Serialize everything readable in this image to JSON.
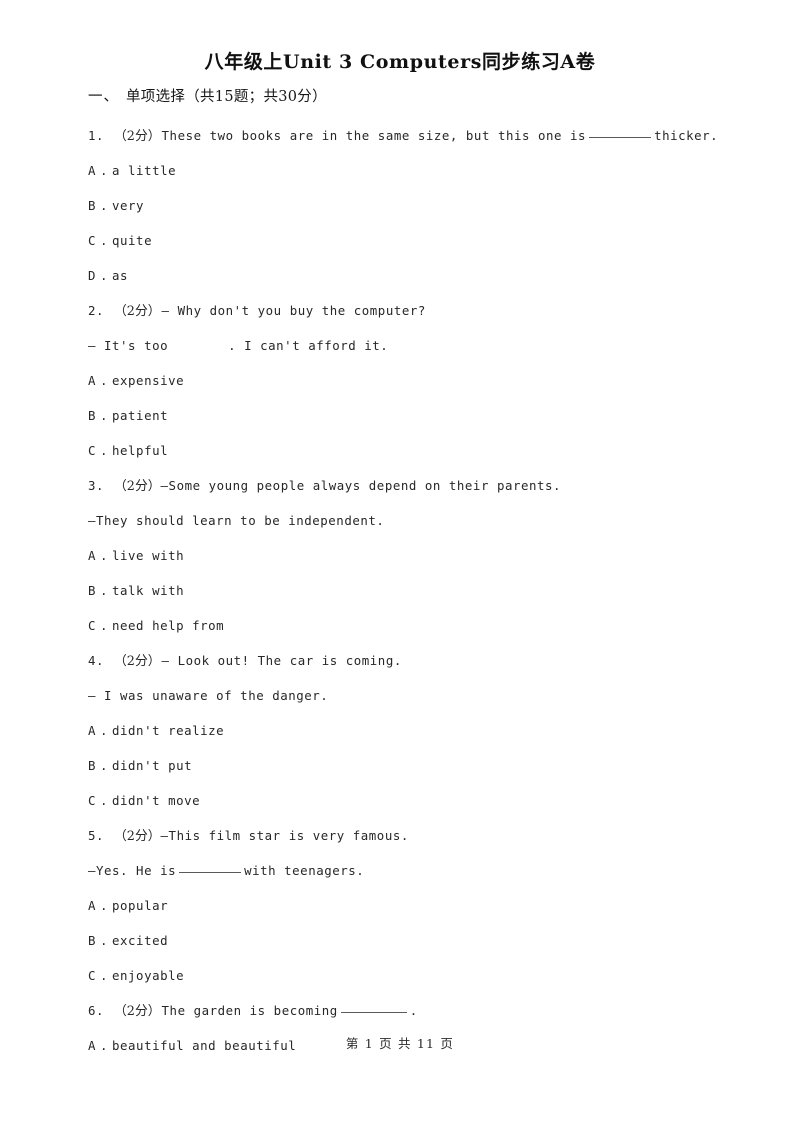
{
  "document": {
    "title": "八年级上Unit 3 Computers同步练习A卷",
    "section": {
      "number": "一、",
      "label": "单项选择（共15题；共30分）"
    },
    "footer": "第 1 页 共 11 页"
  },
  "questions": [
    {
      "number": "1.",
      "points": "（2分）",
      "stem_before": "These two books are in the same size, but this one is",
      "blank": "underline",
      "stem_after": "thicker.",
      "second_line": null,
      "options": [
        {
          "letter": "A",
          "text": "a little"
        },
        {
          "letter": "B",
          "text": "very"
        },
        {
          "letter": "C",
          "text": "quite"
        },
        {
          "letter": "D",
          "text": "as"
        }
      ]
    },
    {
      "number": "2.",
      "points": "（2分）",
      "stem_before": "— Why don't you buy the computer?",
      "blank": "none",
      "stem_after": "",
      "second_line_before": "— It's too",
      "second_line_blank": "gap",
      "second_line_after": ". I can't afford it.",
      "options": [
        {
          "letter": "A",
          "text": "expensive"
        },
        {
          "letter": "B",
          "text": "patient"
        },
        {
          "letter": "C",
          "text": "helpful"
        }
      ]
    },
    {
      "number": "3.",
      "points": "（2分）",
      "stem_before": "—Some young people always depend on their parents.",
      "blank": "none",
      "stem_after": "",
      "second_line": "—They should learn to be independent.",
      "options": [
        {
          "letter": "A",
          "text": "live with"
        },
        {
          "letter": "B",
          "text": "talk with"
        },
        {
          "letter": "C",
          "text": "need help from"
        }
      ]
    },
    {
      "number": "4.",
      "points": "（2分）",
      "stem_before": "— Look out! The car is coming.",
      "blank": "none",
      "stem_after": "",
      "second_line": "— I was unaware of the danger.",
      "options": [
        {
          "letter": "A",
          "text": "didn't realize"
        },
        {
          "letter": "B",
          "text": "didn't put"
        },
        {
          "letter": "C",
          "text": "didn't move"
        }
      ]
    },
    {
      "number": "5.",
      "points": "（2分）",
      "stem_before": "—This film star is very famous.",
      "blank": "none",
      "stem_after": "",
      "second_line_before": "—Yes. He is",
      "second_line_blank": "underline",
      "second_line_after": "with teenagers.",
      "options": [
        {
          "letter": "A",
          "text": "popular"
        },
        {
          "letter": "B",
          "text": "excited"
        },
        {
          "letter": "C",
          "text": "enjoyable"
        }
      ]
    },
    {
      "number": "6.",
      "points": "（2分）",
      "stem_before": "The garden is becoming",
      "blank": "underline",
      "stem_after": ".",
      "second_line": null,
      "options": [
        {
          "letter": "A",
          "text": "beautiful and beautiful"
        }
      ]
    }
  ]
}
